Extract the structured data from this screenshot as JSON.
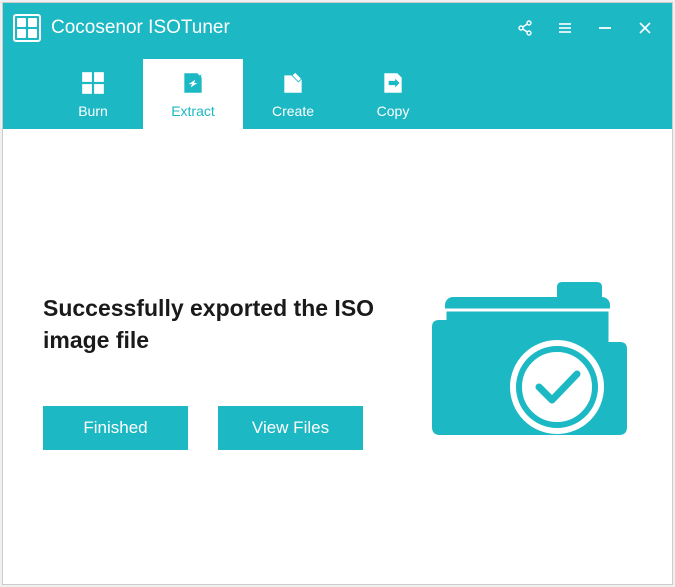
{
  "app": {
    "title": "Cocosenor ISOTuner"
  },
  "tabs": {
    "burn": "Burn",
    "extract": "Extract",
    "create": "Create",
    "copy": "Copy"
  },
  "content": {
    "message": "Successfully exported the ISO image file",
    "finished_label": "Finished",
    "view_files_label": "View Files"
  },
  "colors": {
    "accent": "#1cb8c4"
  }
}
